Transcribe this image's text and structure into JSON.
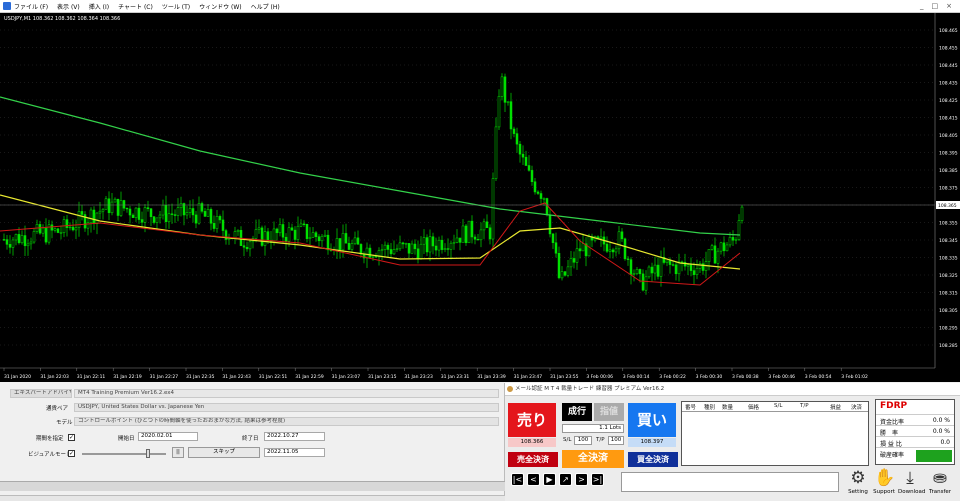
{
  "menu": [
    "ファイル (F)",
    "表示 (V)",
    "挿入 (I)",
    "チャート (C)",
    "ツール (T)",
    "ウィンドウ (W)",
    "ヘルプ (H)"
  ],
  "window_controls": [
    "_",
    "□",
    "×"
  ],
  "chart": {
    "symbol_line": "USDJPY,M1 108.362 108.362 108.364 108.366",
    "current_price_label": "108.365",
    "y_ticks": [
      "108.465",
      "108.455",
      "108.445",
      "108.435",
      "108.425",
      "108.415",
      "108.405",
      "108.395",
      "108.385",
      "108.375",
      "108.365",
      "108.355",
      "108.345",
      "108.335",
      "108.325",
      "108.315",
      "108.305",
      "108.295",
      "108.285"
    ],
    "x_ticks": [
      "31 Jan 2020",
      "31 Jan 22:03",
      "31 Jan 22:11",
      "31 Jan 22:19",
      "31 Jan 22:27",
      "31 Jan 22:35",
      "31 Jan 22:43",
      "31 Jan 22:51",
      "31 Jan 22:59",
      "31 Jan 23:07",
      "31 Jan 23:15",
      "31 Jan 23:23",
      "31 Jan 23:31",
      "31 Jan 23:39",
      "31 Jan 23:47",
      "31 Jan 23:55",
      "3 Feb 00:06",
      "3 Feb 00:14",
      "3 Feb 00:22",
      "3 Feb 00:30",
      "3 Feb 00:38",
      "3 Feb 00:46",
      "3 Feb 00:54",
      "3 Feb 01:02"
    ],
    "colors": {
      "bg": "#000000",
      "candle": "#00e000",
      "ma_green": "#33d14a",
      "ma_yellow": "#e8e830",
      "ma_red": "#d01818"
    }
  },
  "tester": {
    "tab": "エキスパートアドバイザ",
    "ea_name": "MT4 Training Premium Ver16.2.ex4",
    "pair_label": "通貨ペア",
    "pair_value": "USDJPY, United States Dollar vs. Japanese Yen",
    "model_label": "モデル",
    "model_value": "コントロールポイント (ひとつ下の時間軸を使ったおおまかな方法, 結果は参考程度)",
    "period_label": "期間を指定",
    "start_label": "開始日",
    "start_value": "2020.02.01",
    "end_label": "終了日",
    "end_value": "2022.10.27",
    "visual_label": "ビジュアルモード",
    "pause_label": "||",
    "skip_label": "スキップ",
    "skip_date": "2022.11.05"
  },
  "panel": {
    "title": "メール認証 M T 4  裁量トレード  練習器  プレミアム Ver16.2",
    "sell": "売り",
    "sell_price": "108.366",
    "buy": "買い",
    "buy_price": "108.397",
    "market": "成行",
    "limit": "指値",
    "lots_value": "1.1",
    "lots_unit": "Lots",
    "sl_label": "S/L",
    "sl_value": "100",
    "tp_label": "T/P",
    "tp_value": "100",
    "close_sell": "売全決済",
    "close_all": "全決済",
    "close_buy": "買全決済",
    "cols": [
      "番号",
      "種別",
      "数量",
      "価格",
      "S/L",
      "T/P",
      "損益",
      "決済"
    ],
    "stats_title": "FDRP",
    "stats": [
      {
        "k": "資金比率",
        "v": "0.0 %"
      },
      {
        "k": "勝　率",
        "v": "0.0 %"
      },
      {
        "k": "損 益 比",
        "v": "0.0"
      },
      {
        "k": "破産確率",
        "v": ""
      }
    ],
    "nav": [
      "|<",
      "<",
      "▶",
      "↗",
      ">",
      ">|"
    ],
    "tools": [
      "Setting",
      "Support",
      "Download",
      "Transfer"
    ]
  }
}
